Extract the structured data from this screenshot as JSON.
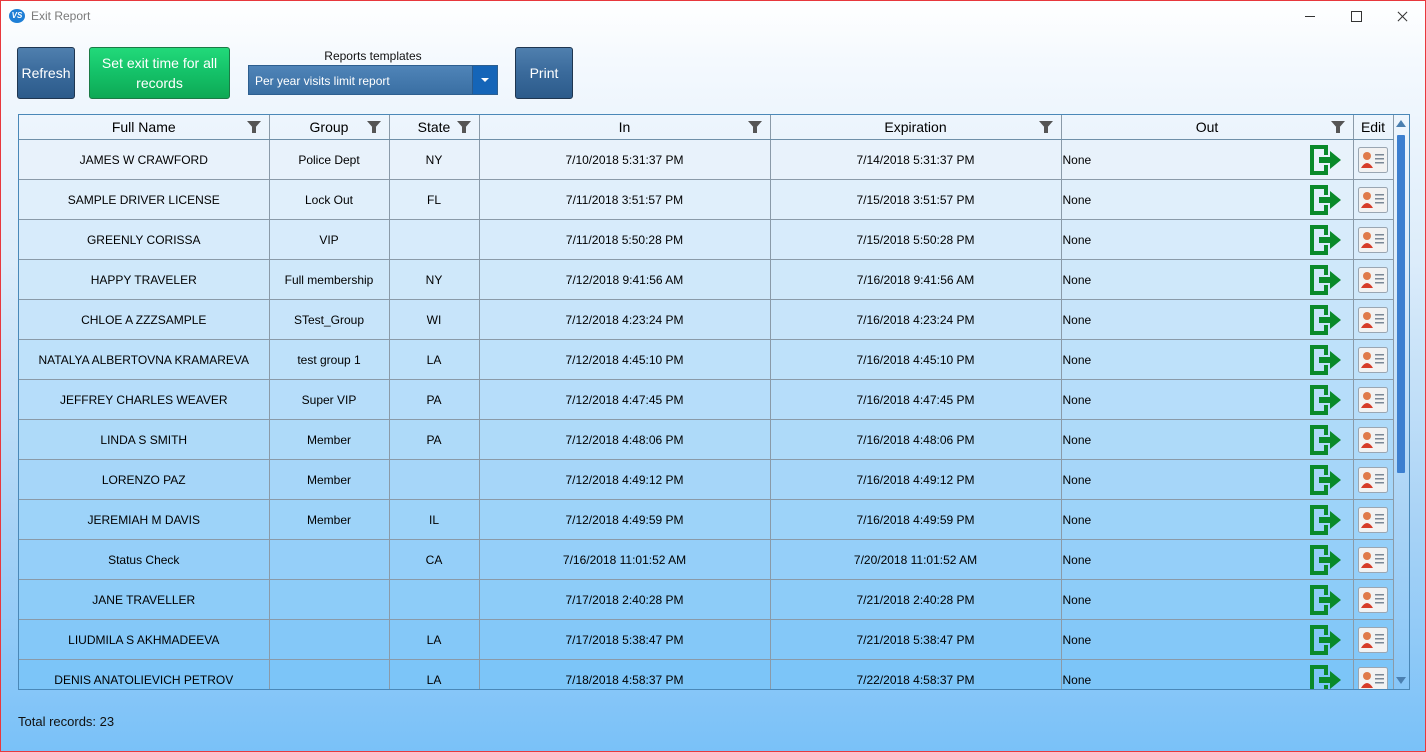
{
  "window": {
    "title": "Exit Report",
    "icon_text": "VS",
    "controls": [
      "minimize",
      "maximize",
      "close"
    ]
  },
  "toolbar": {
    "refresh_label": "Refresh",
    "set_exit_label": "Set exit time for all records",
    "templates_label": "Reports templates",
    "template_selected": "Per year visits limit report",
    "print_label": "Print"
  },
  "grid": {
    "columns": [
      "Full Name",
      "Group",
      "State",
      "In",
      "Expiration",
      "Out",
      "Edit"
    ],
    "rows": [
      {
        "name": "JAMES W CRAWFORD",
        "group": "Police Dept",
        "state": "NY",
        "in": "7/10/2018 5:31:37 PM",
        "exp": "7/14/2018 5:31:37 PM",
        "out": "None"
      },
      {
        "name": "SAMPLE DRIVER LICENSE",
        "group": "Lock Out",
        "state": "FL",
        "in": "7/11/2018 3:51:57 PM",
        "exp": "7/15/2018 3:51:57 PM",
        "out": "None"
      },
      {
        "name": "GREENLY CORISSA",
        "group": "VIP",
        "state": "",
        "in": "7/11/2018 5:50:28 PM",
        "exp": "7/15/2018 5:50:28 PM",
        "out": "None"
      },
      {
        "name": "HAPPY  TRAVELER",
        "group": "Full membership",
        "state": "NY",
        "in": "7/12/2018 9:41:56 AM",
        "exp": "7/16/2018 9:41:56 AM",
        "out": "None"
      },
      {
        "name": "CHLOE A ZZZSAMPLE",
        "group": "STest_Group",
        "state": "WI",
        "in": "7/12/2018 4:23:24 PM",
        "exp": "7/16/2018 4:23:24 PM",
        "out": "None"
      },
      {
        "name": "NATALYA ALBERTOVNA KRAMAREVA",
        "group": "test group 1",
        "state": "LA",
        "in": "7/12/2018 4:45:10 PM",
        "exp": "7/16/2018 4:45:10 PM",
        "out": "None"
      },
      {
        "name": "JEFFREY CHARLES WEAVER",
        "group": "Super VIP",
        "state": "PA",
        "in": "7/12/2018 4:47:45 PM",
        "exp": "7/16/2018 4:47:45 PM",
        "out": "None"
      },
      {
        "name": "LINDA S SMITH",
        "group": "Member",
        "state": "PA",
        "in": "7/12/2018 4:48:06 PM",
        "exp": "7/16/2018 4:48:06 PM",
        "out": "None"
      },
      {
        "name": "LORENZO  PAZ",
        "group": "Member",
        "state": "",
        "in": "7/12/2018 4:49:12 PM",
        "exp": "7/16/2018 4:49:12 PM",
        "out": "None"
      },
      {
        "name": "JEREMIAH M DAVIS",
        "group": "Member",
        "state": "IL",
        "in": "7/12/2018 4:49:59 PM",
        "exp": "7/16/2018 4:49:59 PM",
        "out": "None"
      },
      {
        "name": "Status  Check",
        "group": "",
        "state": "CA",
        "in": "7/16/2018 11:01:52 AM",
        "exp": "7/20/2018 11:01:52 AM",
        "out": "None"
      },
      {
        "name": "JANE  TRAVELLER",
        "group": "",
        "state": "",
        "in": "7/17/2018 2:40:28 PM",
        "exp": "7/21/2018 2:40:28 PM",
        "out": "None"
      },
      {
        "name": "LIUDMILA S AKHMADEEVA",
        "group": "",
        "state": "LA",
        "in": "7/17/2018 5:38:47 PM",
        "exp": "7/21/2018 5:38:47 PM",
        "out": "None"
      },
      {
        "name": "DENIS ANATOLIEVICH PETROV",
        "group": "",
        "state": "LA",
        "in": "7/18/2018 4:58:37 PM",
        "exp": "7/22/2018 4:58:37 PM",
        "out": "None"
      }
    ]
  },
  "footer": {
    "total_label": "Total records: 23"
  },
  "colors": {
    "exit_icon": "#0a8a2a",
    "accent_blue": "#3a6a9b",
    "accent_green": "#14c168"
  },
  "icons": {
    "filter": "filter-icon",
    "exit": "exit-arrow-icon",
    "edit": "edit-user-card-icon"
  }
}
